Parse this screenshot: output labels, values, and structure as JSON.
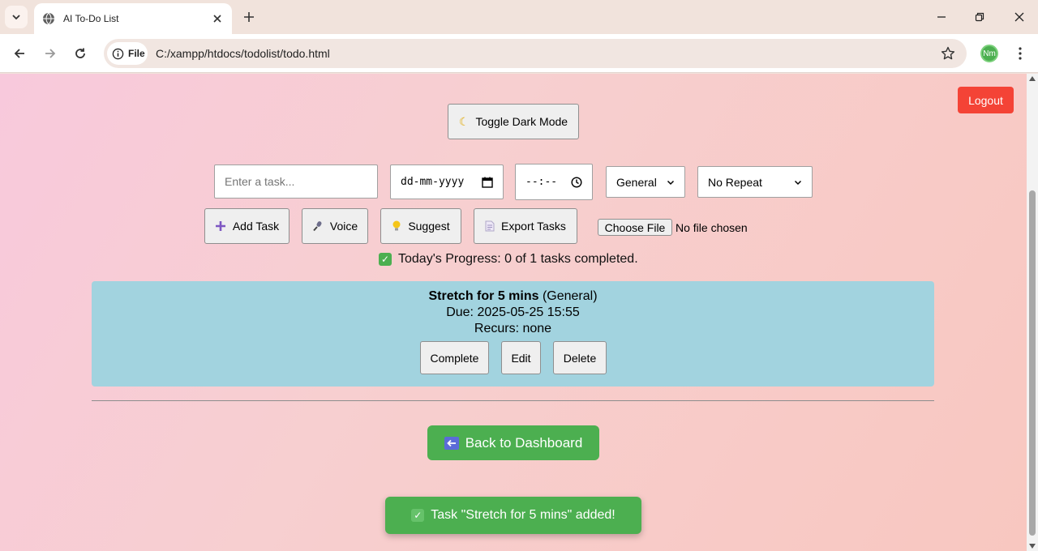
{
  "browser": {
    "tab_title": "AI To-Do List",
    "site_chip": "File",
    "url": "C:/xampp/htdocs/todolist/todo.html",
    "profile_initials": "Nm"
  },
  "page": {
    "logout_label": "Logout",
    "dark_mode": {
      "icon": "moon-icon",
      "label": "Toggle Dark Mode"
    },
    "form": {
      "task_placeholder": "Enter a task...",
      "date_placeholder": "dd-mm-yyyy",
      "time_placeholder": "--:--",
      "category_value": "General",
      "repeat_value": "No Repeat"
    },
    "actions": {
      "add_task": "Add Task",
      "voice": "Voice",
      "suggest": "Suggest",
      "export": "Export Tasks",
      "choose_file": "Choose File",
      "no_file": "No file chosen"
    },
    "progress_text": "Today's Progress: 0 of 1 tasks completed.",
    "task": {
      "title": "Stretch for 5 mins",
      "category": "(General)",
      "due": "Due: 2025-05-25 15:55",
      "recurs": "Recurs: none",
      "complete_label": "Complete",
      "edit_label": "Edit",
      "delete_label": "Delete",
      "card_color": "#a2d3df"
    },
    "back_label": "Back to Dashboard",
    "toast_text": "Task \"Stretch for 5 mins\" added!",
    "colors": {
      "green": "#4caf50",
      "logout_red": "#f44336"
    }
  }
}
